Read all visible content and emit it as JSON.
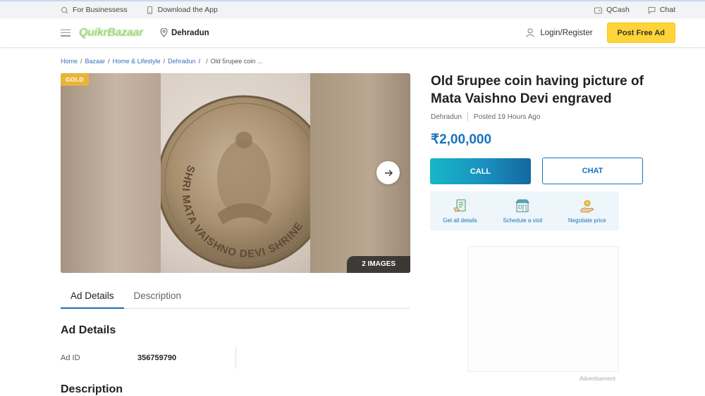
{
  "topbar": {
    "for_business": "For Businessess",
    "download_app": "Download the App",
    "qcash": "QCash",
    "chat": "Chat"
  },
  "header": {
    "logo_text": "QuikrBazaar",
    "location": "Dehradun",
    "login": "Login/Register",
    "post_ad": "Post Free Ad"
  },
  "breadcrumb": {
    "items": [
      "Home",
      "Bazaar",
      "Home & Lifestyle",
      "Dehradun",
      ""
    ],
    "current": "Old 5rupee coin ..."
  },
  "gallery": {
    "badge": "GOLD",
    "image_count": "2 IMAGES",
    "coin_text": "SHRI MATA VAISHNO DEVI SHRINE"
  },
  "tabs": [
    {
      "label": "Ad Details",
      "active": true
    },
    {
      "label": "Description",
      "active": false
    }
  ],
  "details": {
    "section_title": "Ad Details",
    "ad_id_label": "Ad ID",
    "ad_id_value": "356759790",
    "description_title": "Description"
  },
  "listing": {
    "title": "Old 5rupee coin having picture of Mata Vaishno Devi engraved",
    "location": "Dehradun",
    "posted": "Posted 19 Hours Ago",
    "price": "₹2,00,000",
    "call_label": "CALL",
    "chat_label": "CHAT"
  },
  "actions": [
    {
      "label": "Get all details",
      "icon": "document-icon"
    },
    {
      "label": "Schedule a visit",
      "icon": "storefront-icon"
    },
    {
      "label": "Negotiate price",
      "icon": "hand-coin-icon"
    }
  ],
  "advertisement_label": "Advertisement",
  "colors": {
    "accent_blue": "#1a72bb",
    "post_ad_yellow": "#ffd438",
    "gold_badge": "#e9b43a"
  }
}
